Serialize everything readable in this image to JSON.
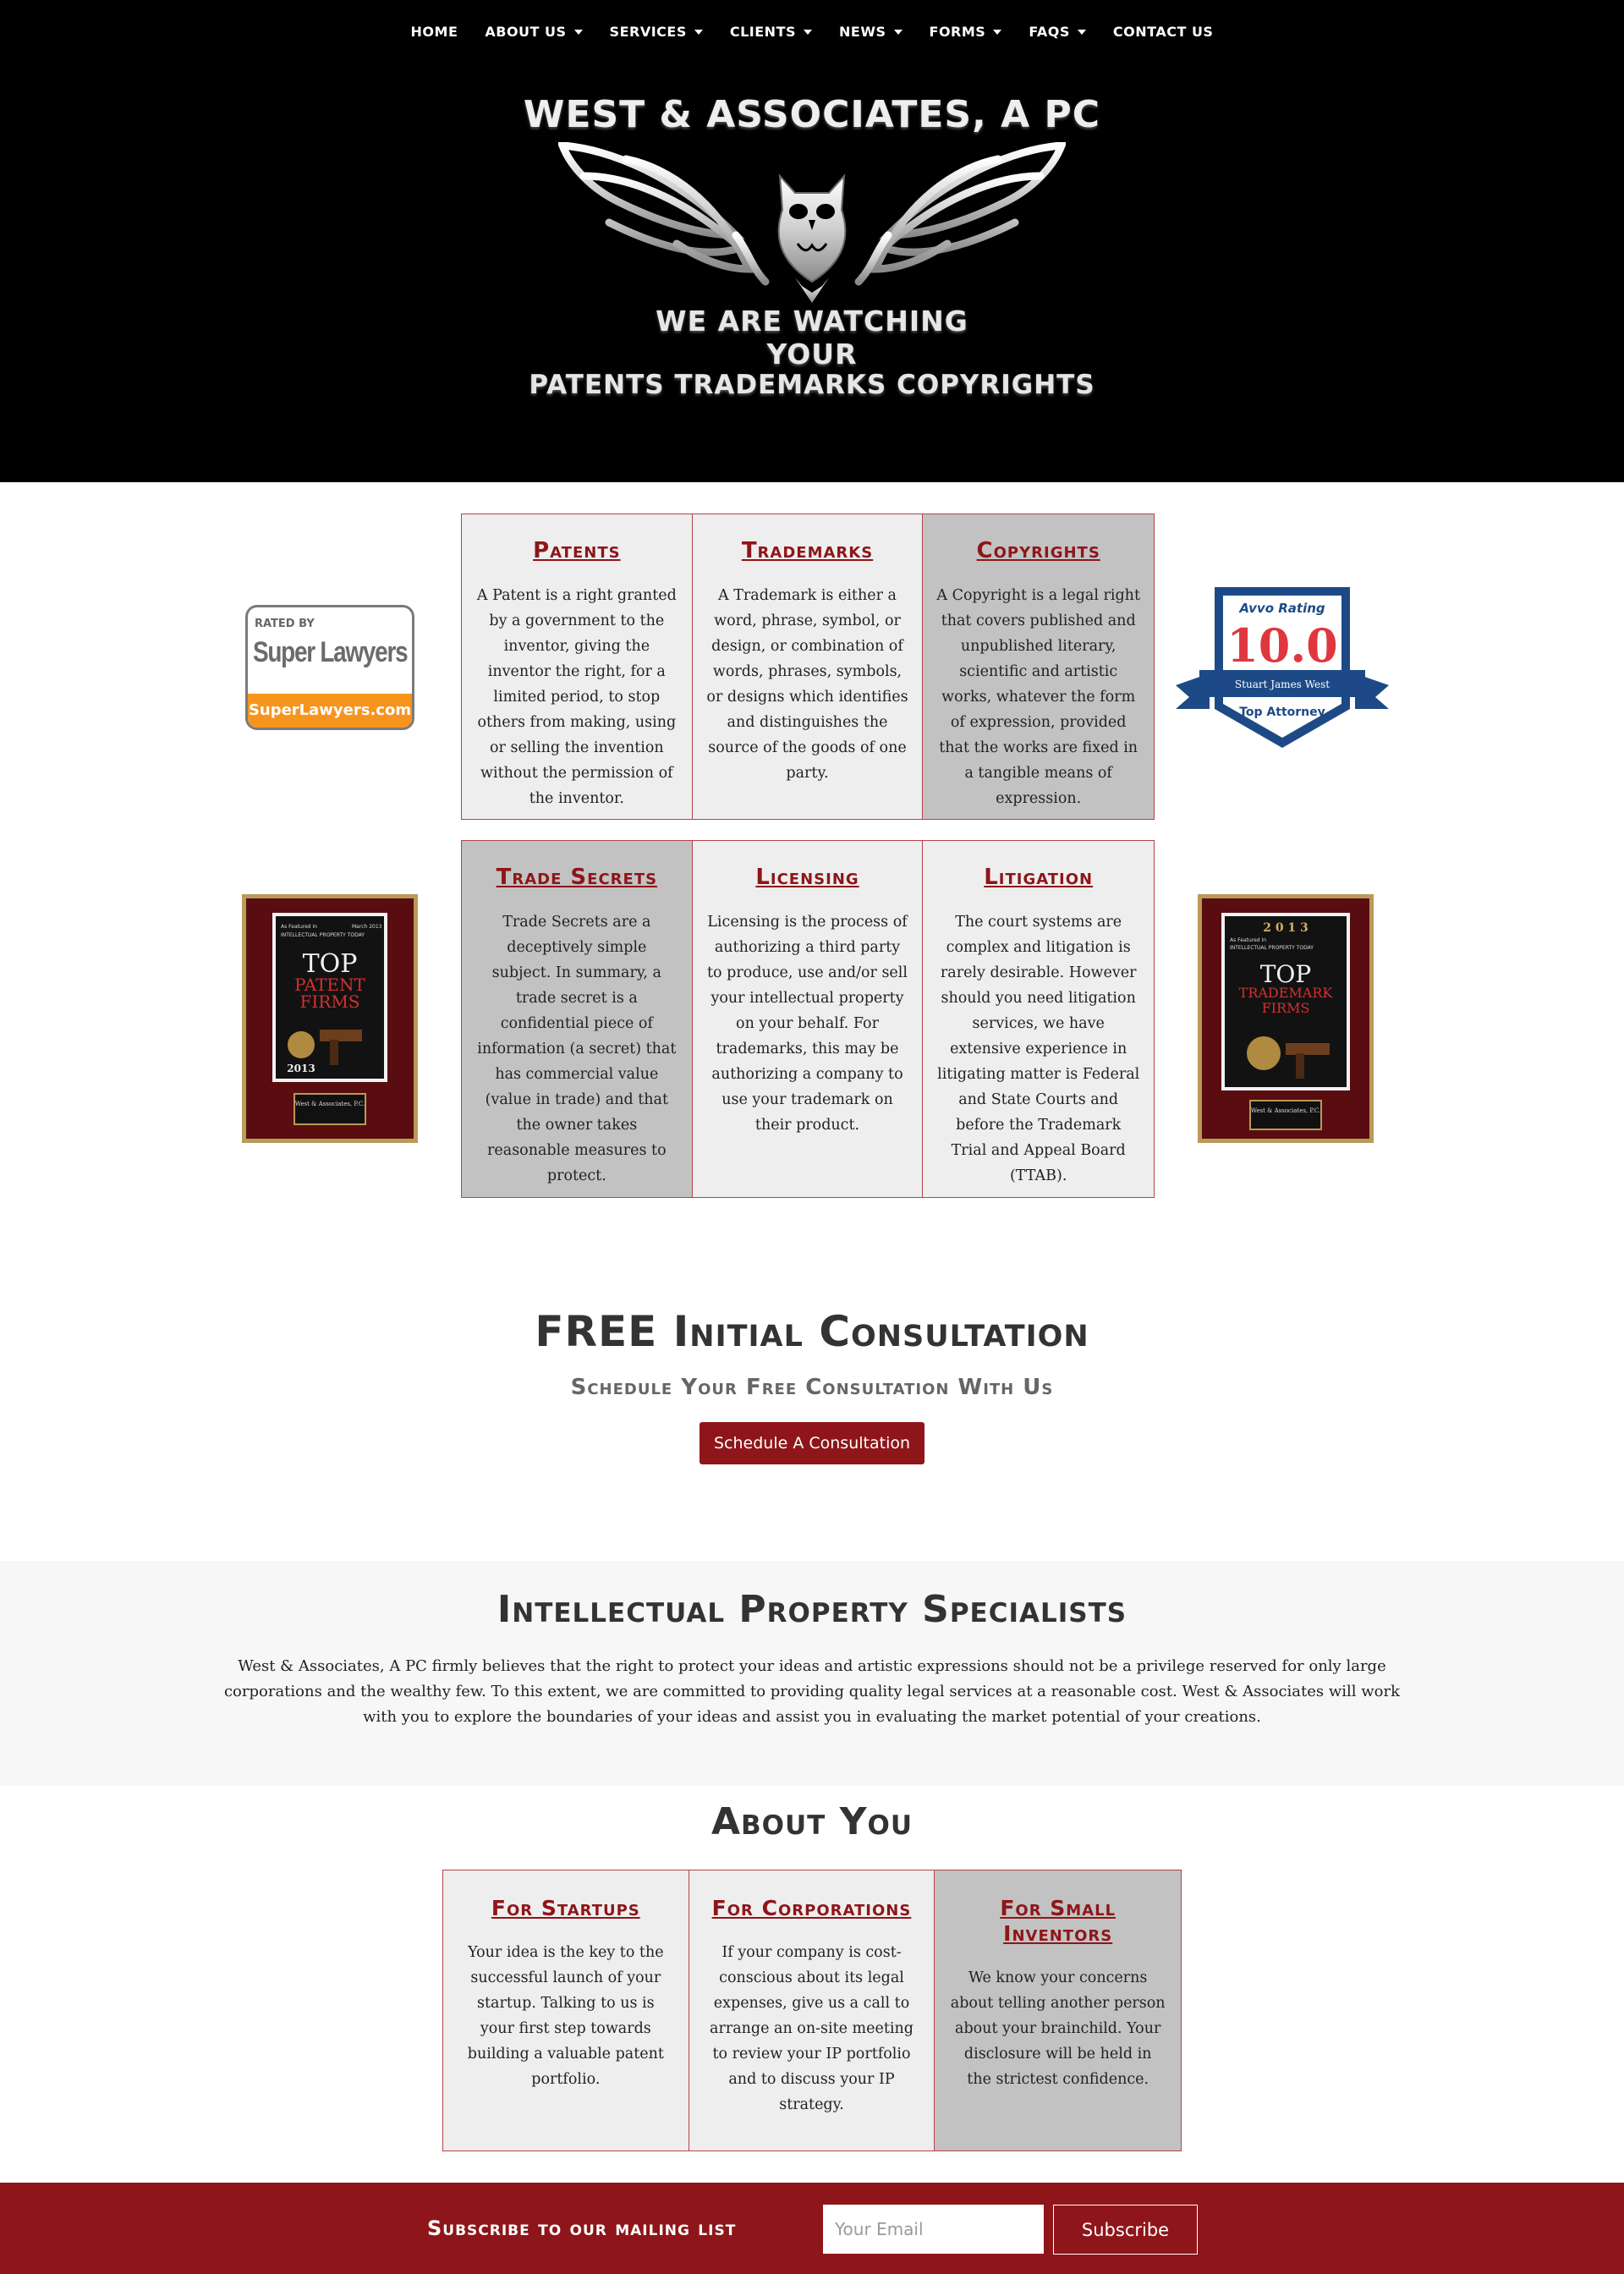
{
  "nav": {
    "items": [
      {
        "label": "HOME",
        "dropdown": false
      },
      {
        "label": "ABOUT US",
        "dropdown": true
      },
      {
        "label": "SERVICES",
        "dropdown": true
      },
      {
        "label": "CLIENTS",
        "dropdown": true
      },
      {
        "label": "NEWS",
        "dropdown": true
      },
      {
        "label": "FORMS",
        "dropdown": true
      },
      {
        "label": "FAQS",
        "dropdown": true
      },
      {
        "label": "CONTACT US",
        "dropdown": false
      }
    ]
  },
  "hero": {
    "firm_name": "WEST & ASSOCIATES, A PC",
    "tagline_1": "WE ARE WATCHING",
    "tagline_2": "YOUR",
    "tagline_3": "PATENTS TRADEMARKS COPYRIGHTS"
  },
  "services_row1": [
    {
      "title": "Patents",
      "text": "A Patent is a right granted by a government to the inventor, giving the inventor the right, for a limited period, to stop others from making, using or selling the invention without the permission of the inventor."
    },
    {
      "title": "Trademarks",
      "text": "A Trademark is either a word, phrase, symbol, or design, or combination of words, phrases, symbols, or designs which identifies and distinguishes the source of the goods of one party."
    },
    {
      "title": "Copyrights",
      "text": "A Copyright is a legal right that covers published and unpublished literary, scientific and artistic works, whatever the form of expression, provided that the works are fixed in a tangible means of expression."
    }
  ],
  "services_row2": [
    {
      "title": "Trade Secrets",
      "text": "Trade Secrets are a deceptively simple subject. In summary, a trade secret is a confidential piece of information (a secret) that has commercial value (value in trade) and that the owner takes reasonable measures to protect."
    },
    {
      "title": "Licensing",
      "text": "Licensing is the process of authorizing a third party to produce, use and/or sell your intellectual property on your behalf. For trademarks, this may be authorizing a company to use your trademark on their product."
    },
    {
      "title": "Litigation",
      "text": "The court systems are complex and litigation is rarely desirable. However should you need litigation services, we have extensive experience in litigating matter is Federal and State Courts and before the Trademark Trial and Appeal Board (TTAB)."
    }
  ],
  "badges": {
    "superlawyers": {
      "rated_by": "RATED BY",
      "name": "Super Lawyers",
      "url_text": "SuperLawyers.com"
    },
    "avvo": {
      "heading": "Avvo Rating",
      "score": "10.0",
      "attorney": "Stuart James West",
      "label": "Top Attorney"
    },
    "plaque_left": {
      "line1": "As Featured In",
      "line2": "INTELLECTUAL PROPERTY TODAY",
      "date": "March 2013",
      "title1": "TOP",
      "title2": "PATENT",
      "title3": "FIRMS",
      "year": "2013",
      "firm": "West & Associates, P.C."
    },
    "plaque_right": {
      "year_top": "2 0 1 3",
      "line1": "As Featured In",
      "line2": "INTELLECTUAL PROPERTY TODAY",
      "title1": "TOP",
      "title2": "TRADEMARK",
      "title3": "FIRMS",
      "firm": "West & Associates, P.C."
    }
  },
  "consultation": {
    "title": "FREE Initial Consultation",
    "subtitle": "Schedule Your Free Consultation With Us",
    "button": "Schedule A Consultation"
  },
  "ip": {
    "title": "Intellectual Property Specialists",
    "text": "West & Associates, A PC firmly believes that the right to protect your ideas and artistic expressions should not be a privilege reserved for only large corporations and the wealthy few. To this extent, we are committed to providing quality legal services at a reasonable cost. West & Associates will work with you to explore the boundaries of your ideas and assist you in evaluating the market potential of your creations."
  },
  "about": {
    "title": "About You",
    "cards": [
      {
        "title": "For Startups",
        "text": "Your idea is the key to the successful launch of your startup. Talking to us is your first step towards building a valuable patent portfolio."
      },
      {
        "title": "For Corporations",
        "text": "If your company is cost-conscious about its legal expenses, give us a call to arrange an on-site meeting to review your IP portfolio and to discuss your IP strategy."
      },
      {
        "title": "For Small Inventors",
        "text": "We know your concerns about telling another person about your brainchild. Your disclosure will be held in the strictest confidence."
      }
    ]
  },
  "footer": {
    "label": "Subscribe to our mailing list",
    "email_placeholder": "Your Email",
    "button": "Subscribe"
  },
  "colors": {
    "accent": "#8e1519",
    "header_bg": "#000000",
    "cell_light": "#eeeeee",
    "cell_dark": "#c2c2c2",
    "avvo_blue": "#1d4a87",
    "superlawyers_orange": "#f7941d"
  }
}
